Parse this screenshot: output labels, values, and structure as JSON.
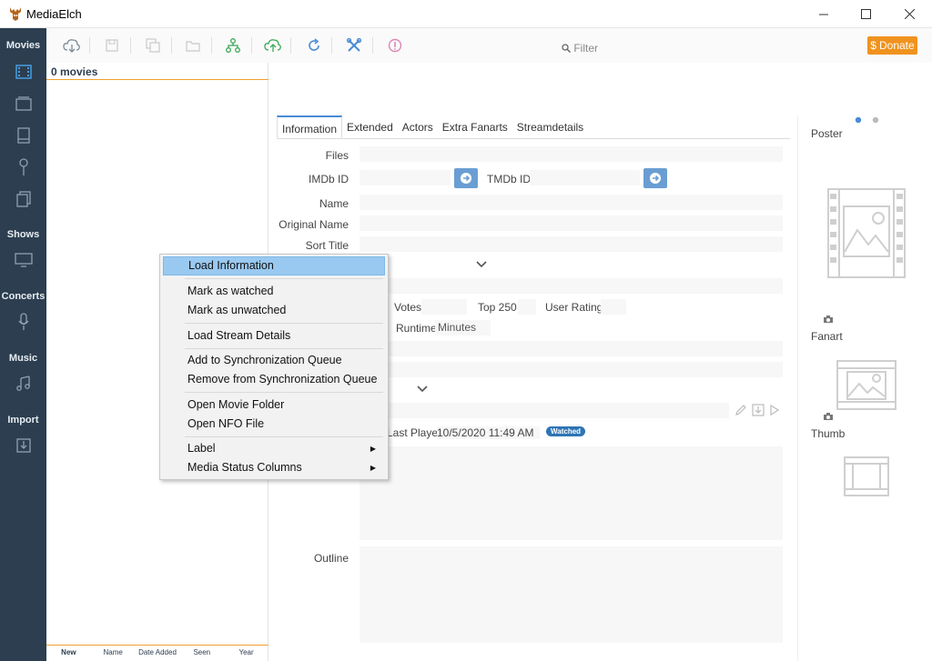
{
  "app": {
    "title": "MediaElch"
  },
  "sidebar": {
    "sections": [
      {
        "label": "Movies"
      },
      {
        "label": "Shows"
      },
      {
        "label": "Concerts"
      },
      {
        "label": "Music"
      },
      {
        "label": "Import"
      }
    ]
  },
  "toolbar": {
    "filter_placeholder": "Filter",
    "donate_label": "Donate",
    "donate_symbol": "$"
  },
  "list": {
    "count_label": "0 movies",
    "columns": [
      "New",
      "Name",
      "Date Added",
      "Seen",
      "Year"
    ]
  },
  "tabs": [
    "Information",
    "Extended",
    "Actors",
    "Extra Fanarts",
    "Streamdetails"
  ],
  "form": {
    "files_label": "Files",
    "imdb_label": "IMDb ID",
    "tmdb_label": "TMDb ID",
    "name_label": "Name",
    "original_name_label": "Original Name",
    "sort_title_label": "Sort Title",
    "votes_label": "Votes",
    "top250_label": "Top 250",
    "user_rating_label": "User Rating",
    "runtime_label": "Runtime",
    "runtime_value": "Minutes",
    "last_played_label": "Last Played",
    "last_played_value": "10/5/2020 11:49 AM",
    "watched_badge": "Watched",
    "outline_label": "Outline"
  },
  "right_panel": {
    "poster_label": "Poster",
    "fanart_label": "Fanart",
    "thumb_label": "Thumb"
  },
  "context_menu": {
    "items": [
      {
        "label": "Load Information",
        "highlighted": true
      },
      {
        "label": "Mark as watched"
      },
      {
        "label": "Mark as unwatched"
      },
      {
        "label": "Load Stream Details"
      },
      {
        "label": "Add to Synchronization Queue"
      },
      {
        "label": "Remove from Synchronization Queue"
      },
      {
        "label": "Open Movie Folder"
      },
      {
        "label": "Open NFO File"
      },
      {
        "label": "Label",
        "submenu": true
      },
      {
        "label": "Media Status Columns",
        "submenu": true
      }
    ]
  },
  "colors": {
    "sidebar": "#2c3e50",
    "accent": "#4a8bd6",
    "donate": "#f0931e",
    "highlight": "#99c9f0"
  }
}
